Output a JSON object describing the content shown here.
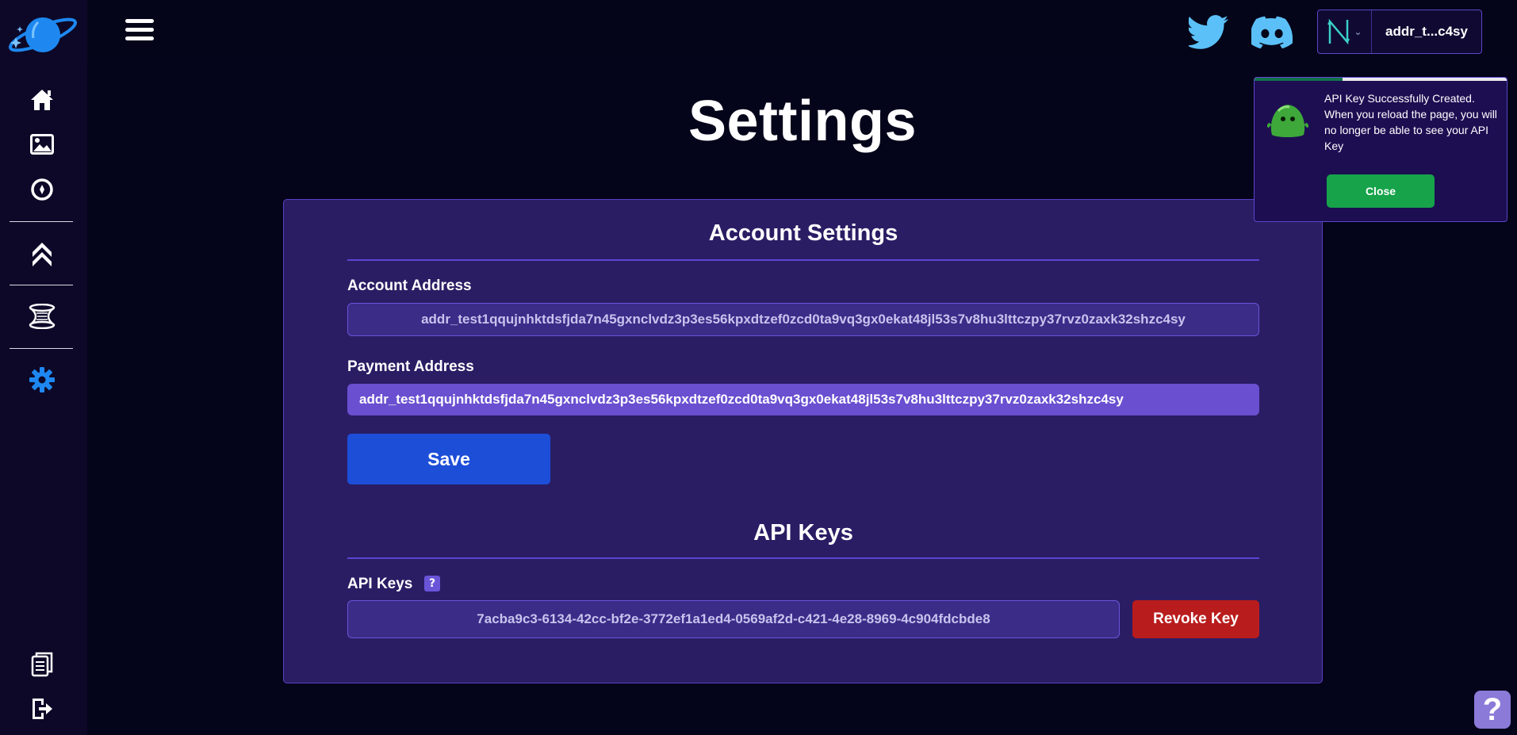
{
  "page": {
    "title": "Settings"
  },
  "header": {
    "wallet_address_short": "addr_t...c4sy"
  },
  "account_settings": {
    "title": "Account Settings",
    "account_address_label": "Account Address",
    "account_address_value": "addr_test1qqujnhktdsfjda7n45gxnclvdz3p3es56kpxdtzef0zcd0ta9vq3gx0ekat48jl53s7v8hu3lttczpy37rvz0zaxk32shzc4sy",
    "payment_address_label": "Payment Address",
    "payment_address_value": "addr_test1qqujnhktdsfjda7n45gxnclvdz3p3es56kpxdtzef0zcd0ta9vq3gx0ekat48jl53s7v8hu3lttczpy37rvz0zaxk32shzc4sy",
    "save_label": "Save"
  },
  "api_keys": {
    "title": "API Keys",
    "label": "API Keys",
    "help_glyph": "?",
    "key_value": "7acba9c3-6134-42cc-bf2e-3772ef1a1ed4-0569af2d-c421-4e28-8969-4c904fdcbde8",
    "revoke_label": "Revoke Key"
  },
  "toast": {
    "message": "API Key Successfully Created. When you reload the page, you will no longer be able to see your API Key",
    "close_label": "Close",
    "progress": 0.35
  },
  "help_fab": {
    "glyph": "?"
  },
  "icons": {
    "sidebar": [
      "home-icon",
      "image-icon",
      "compass-icon",
      "chevrons-up-icon",
      "portal-icon",
      "gear-icon",
      "documents-icon",
      "logout-icon"
    ],
    "header": [
      "menu-icon",
      "twitter-icon",
      "discord-icon",
      "nami-wallet-icon"
    ]
  },
  "colors": {
    "background": "#04041a",
    "card": "#2a1d64",
    "accent_blue": "#1d4ed8",
    "danger": "#b91c1c",
    "success": "#16a34a",
    "active_sidebar": "#1e88f0",
    "social": "#5bc0f8"
  }
}
